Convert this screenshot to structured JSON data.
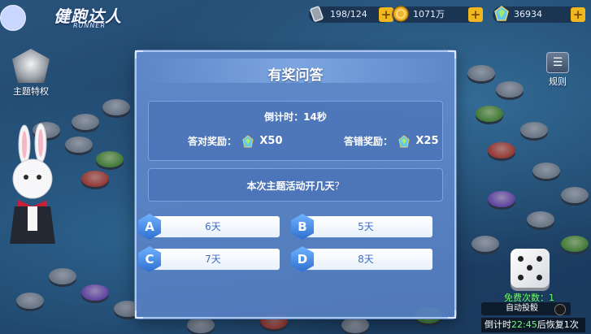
{
  "hud": {
    "game_title": "健跑达人",
    "game_subtitle": "RUNNER",
    "resources": [
      {
        "name": "energy",
        "value": "198/124",
        "icon": "battery-icon"
      },
      {
        "name": "coins",
        "value": "1071万",
        "icon": "coin-icon"
      },
      {
        "name": "gems",
        "value": "36934",
        "icon": "gem-icon"
      }
    ],
    "plus_label": "+"
  },
  "side": {
    "theme_label": "主题特权",
    "rule_label": "规则"
  },
  "dialog": {
    "title": "有奖问答",
    "countdown": "倒计时：14秒",
    "correct_reward_label": "答对奖励：",
    "correct_reward_amount": "X50",
    "wrong_reward_label": "答错奖励：",
    "wrong_reward_amount": "X25",
    "question": "本次主题活动开几天",
    "question_mark": "？",
    "options": [
      {
        "letter": "A",
        "text": "6天"
      },
      {
        "letter": "B",
        "text": "5天"
      },
      {
        "letter": "C",
        "text": "7天"
      },
      {
        "letter": "D",
        "text": "8天"
      }
    ]
  },
  "bottom": {
    "free_dice": "免费次数：1",
    "auto_dice": "自动投骰",
    "countdown_prefix": "倒计时",
    "countdown_time": "22:45",
    "countdown_suffix": "后恢复1次"
  },
  "colors": {
    "accent": "#3b6fc4",
    "gold": "#f0b81c",
    "green_text": "#6dff74"
  }
}
